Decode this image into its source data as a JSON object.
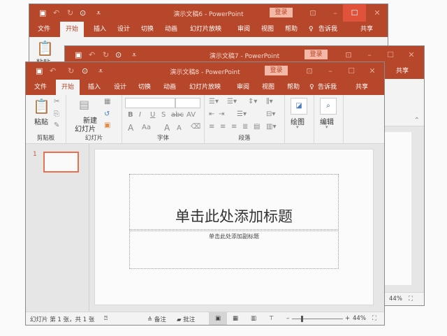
{
  "app": "PowerPoint",
  "colors": {
    "accent": "#b7472a",
    "login_bg": "#f4b8a6",
    "thumb_border": "#e8704f",
    "maximize_hover": "#e0533a"
  },
  "windows": [
    {
      "title": "演示文稿6  -  PowerPoint"
    },
    {
      "title": "演示文稿7  -  PowerPoint"
    },
    {
      "title": "演示文稿8  -  PowerPoint"
    }
  ],
  "titlebar": {
    "login": "登录",
    "icons": [
      "save-icon",
      "undo-icon",
      "redo-icon",
      "presentation-start-icon",
      "customize-qat-icon",
      "ribbon-display-icon",
      "minimize-icon",
      "maximize-icon",
      "close-icon"
    ]
  },
  "tabs": [
    "文件",
    "开始",
    "插入",
    "设计",
    "切换",
    "动画",
    "幻灯片放映",
    "审阅",
    "视图",
    "帮助"
  ],
  "tell_me": "告诉我",
  "share": "共享",
  "ribbon": {
    "clipboard": {
      "paste": "粘贴",
      "label": "剪贴板"
    },
    "slides": {
      "new_slide_1": "新建",
      "new_slide_2": "幻灯片",
      "label": "幻灯片"
    },
    "font": {
      "label": "字体",
      "bold": "B",
      "italic": "I",
      "underline": "U",
      "strike": "S",
      "abc": "abc",
      "spacing": "AV",
      "fontcolor": "A",
      "case": "Aa",
      "grow": "A",
      "shrink": "A"
    },
    "paragraph": {
      "label": "段落"
    },
    "drawing": {
      "label": "绘图"
    },
    "editing": {
      "label": "编辑"
    }
  },
  "thumb": {
    "number": "1"
  },
  "slide": {
    "title_placeholder": "单击此处添加标题",
    "subtitle_placeholder": "单击此处添加副标题"
  },
  "status": {
    "slide_info": "幻灯片 第 1 张，共 1 张",
    "notes": "备注",
    "comments": "批注",
    "zoom": "44%",
    "zoom_percent": 44
  }
}
